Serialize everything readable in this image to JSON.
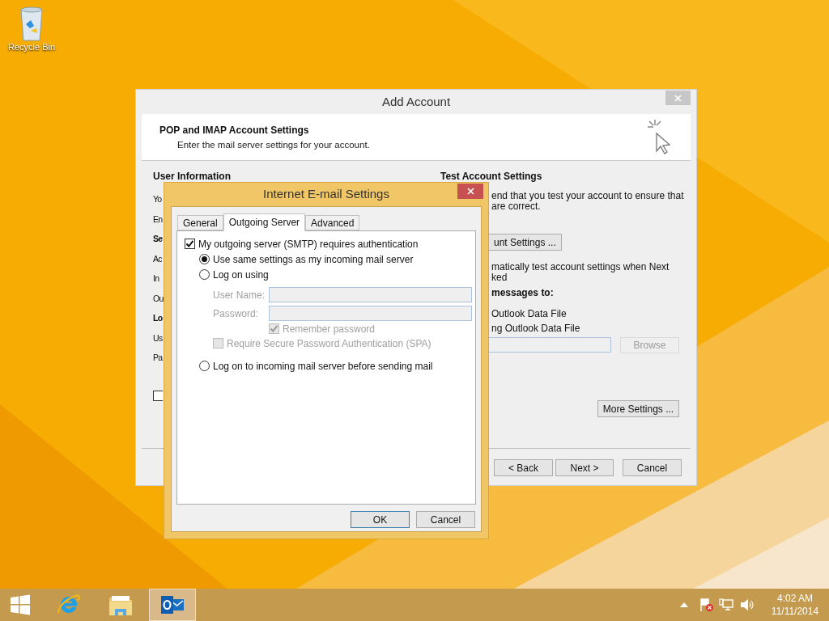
{
  "desktop_icons": [
    {
      "label": "Recycle Bin"
    }
  ],
  "add_account": {
    "title": "Add Account",
    "heading": "POP and IMAP Account Settings",
    "subheading": "Enter the mail server settings for your account.",
    "left_labels": [
      {
        "text": "User Information",
        "kind": "heading"
      },
      {
        "text": "Yo",
        "kind": "label"
      },
      {
        "text": "En",
        "kind": "label"
      },
      {
        "text": "Se",
        "kind": "heading"
      },
      {
        "text": "Ac",
        "kind": "label"
      },
      {
        "text": "In",
        "kind": "label"
      },
      {
        "text": "Ou",
        "kind": "label"
      },
      {
        "text": "Lo",
        "kind": "heading"
      },
      {
        "text": "Us",
        "kind": "label"
      },
      {
        "text": "Pa",
        "kind": "label"
      }
    ],
    "left_checkbox": {
      "checked": false
    },
    "test_heading": "Test Account Settings",
    "test_lines": [
      "end that you test your account to ensure that",
      "are correct."
    ],
    "test_button": "unt Settings ...",
    "auto_test_lines": [
      "matically test account settings when Next",
      "ked"
    ],
    "deliver_heading": "messages to:",
    "deliver_options": [
      "Outlook Data File",
      "ng Outlook Data File"
    ],
    "browse": {
      "label": "Browse",
      "disabled": true
    },
    "more_settings": "More Settings ...",
    "buttons": [
      {
        "label": "< Back"
      },
      {
        "label": "Next >"
      },
      {
        "label": "Cancel"
      }
    ]
  },
  "email_settings": {
    "title": "Internet E-mail Settings",
    "tabs": [
      {
        "label": "General",
        "selected": false
      },
      {
        "label": "Outgoing Server",
        "selected": true
      },
      {
        "label": "Advanced",
        "selected": false
      }
    ],
    "require_auth": {
      "label": "My outgoing server (SMTP) requires authentication",
      "checked": true
    },
    "auth_options": [
      {
        "label": "Use same settings as my incoming mail server",
        "selected": true
      },
      {
        "label": "Log on using",
        "selected": false
      },
      {
        "label": "Log on to incoming mail server before sending mail",
        "selected": false
      }
    ],
    "fields": [
      {
        "label": "User Name:",
        "disabled": true
      },
      {
        "label": "Password:",
        "disabled": true
      }
    ],
    "remember_password": {
      "label": "Remember password",
      "checked": true,
      "disabled": true
    },
    "spa": {
      "label": "Require Secure Password Authentication (SPA)",
      "checked": false,
      "disabled": true
    },
    "buttons": [
      {
        "label": "OK"
      },
      {
        "label": "Cancel"
      }
    ]
  },
  "taskbar": {
    "apps": [
      {
        "kind": "browser",
        "selected": false
      },
      {
        "kind": "folder",
        "selected": false
      },
      {
        "kind": "mail",
        "selected": true
      }
    ],
    "time": "4:02 AM",
    "date": "11/11/2014"
  }
}
